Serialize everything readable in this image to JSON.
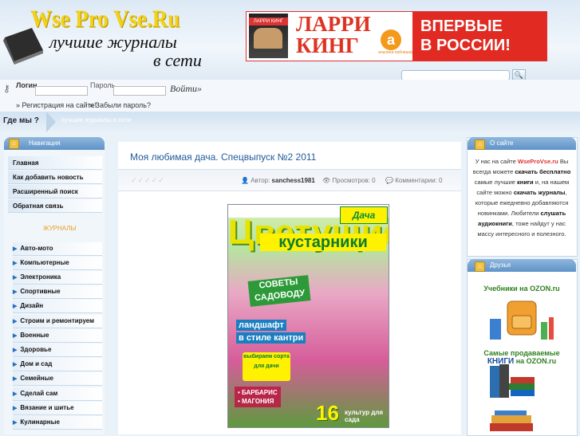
{
  "logo": {
    "title": "Wse Pro Vse.Ru",
    "subtitle1": "лучшие журналы",
    "subtitle2": "в сети"
  },
  "ad": {
    "book_name": "ЛАРРИ КИНГ",
    "name_line1": "ЛАРРИ",
    "name_line2": "КИНГ",
    "publisher": "альпина паблишер",
    "banner_line1": "ВПЕРВЫЕ",
    "banner_line2": "В РОССИИ!"
  },
  "login": {
    "login_label": "Логин",
    "password_label": "Пароль",
    "enter_label": "Войти",
    "register_link": "» Регистрация на сайте!",
    "forgot_link": "» Забыли пароль?"
  },
  "breadcrumb": {
    "where_label": "Где мы ?",
    "current": "лучшие журналы в сети"
  },
  "nav": {
    "header": "Навигация",
    "items": [
      "Главная",
      "Как добавить новость",
      "Расширенный поиск",
      "Обратная связь"
    ]
  },
  "magazines": {
    "header": "ЖУРНАЛЫ",
    "items": [
      "Авто-мото",
      "Компьютерные",
      "Электроника",
      "Спортивные",
      "Дизайн",
      "Строим и ремонтируем",
      "Военные",
      "Здоровье",
      "Дом и сад",
      "Семейные",
      "Сделай сам",
      "Вязание и шитье",
      "Кулинарные"
    ]
  },
  "post": {
    "title": "Моя любимая дача. Спецвыпуск №2 2011",
    "stars": "✓✓✓✓✓",
    "author_label": "Автор:",
    "author": "sanchess1981",
    "views_label": "Просмотров:",
    "views": "0",
    "comments_label": "Комментарии:",
    "comments": "0"
  },
  "cover": {
    "dacha": "Дача",
    "big1": "Цветущие",
    "big2": "кустарники",
    "tag1": "СОВЕТЫ САДОВОДУ",
    "tag2a": "ландшафт",
    "tag2b": "в стиле кантри",
    "tag3": "выбираем сорта для дачи",
    "tag4a": "• БАРБАРИС",
    "tag4b": "• МАГОНИЯ",
    "num": "16",
    "num_sub": "культур для сада"
  },
  "about": {
    "header": "О сайте",
    "p1": "У нас на сайте",
    "brand": "WseProVse.ru",
    "p2": "Вы всегда можете",
    "b1": "скачать бесплатно",
    "p3": "самые лучшие",
    "b2": "книги",
    "p4": "и, на нашем сайте можно",
    "b3": "скачать журналы",
    "p5": ", которые ежедневно добавляются новинками. Любители",
    "b4": "слушать аудиокниги",
    "p6": ", тоже найдут у нас массу интересного и полезного."
  },
  "friends": {
    "header": "Друзья",
    "link1": "Учебники на OZON.ru",
    "link2a": "Самые продаваемые",
    "link2b": "КНИГИ",
    "link2c": "на OZON.ru"
  }
}
